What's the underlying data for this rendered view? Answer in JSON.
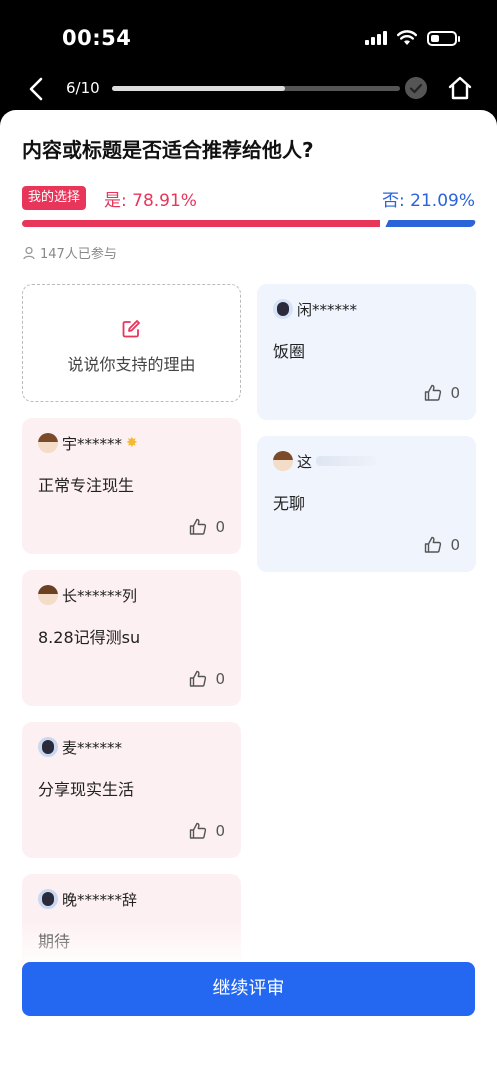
{
  "status_bar": {
    "time": "00:54"
  },
  "nav": {
    "progress_label": "6/10",
    "progress": 0.6
  },
  "question": "内容或标题是否适合推荐给他人?",
  "vote": {
    "my_choice_label": "我的选择",
    "yes_label": "是:",
    "yes_pct": "78.91%",
    "no_label": "否:",
    "no_pct": "21.09%",
    "yes_value": 0.7891,
    "no_value": 0.2109,
    "yes_color": "#e8355a",
    "no_color": "#2b63d9"
  },
  "participants": "147人已参与",
  "reason_prompt": "说说你支持的理由",
  "left_comments": [
    {
      "user": "宇******",
      "text": "正常专注现生",
      "likes": "0"
    },
    {
      "user": "长******列",
      "text": "8.28记得测su",
      "likes": "0"
    },
    {
      "user": "麦******",
      "text": "分享现实生活",
      "likes": "0"
    },
    {
      "user": "晚******辞",
      "text": "期待",
      "likes": ""
    }
  ],
  "right_comments": [
    {
      "user": "闲******",
      "text": "饭圈",
      "likes": "0"
    },
    {
      "user": "这",
      "text": "无聊",
      "likes": "0"
    }
  ],
  "continue_label": "继续评审",
  "accent_color": "#2468f2"
}
